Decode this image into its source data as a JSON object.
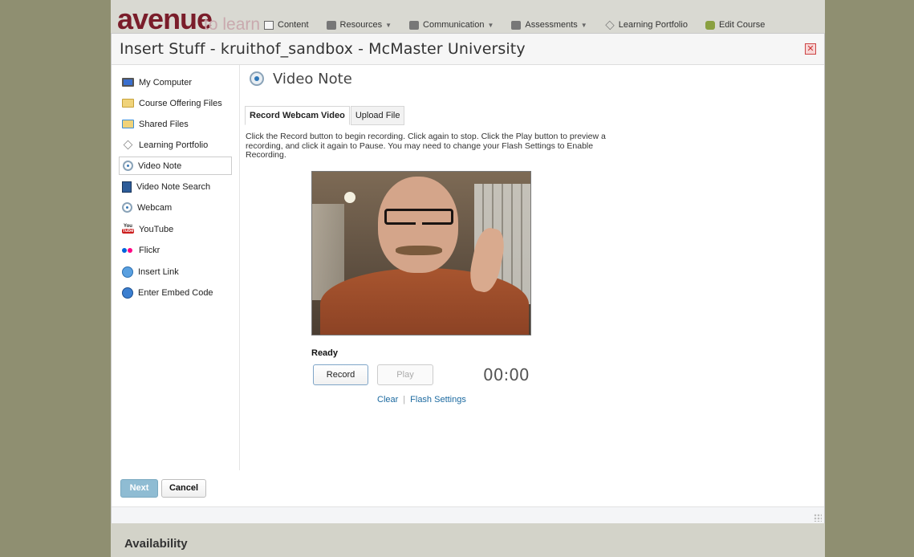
{
  "site": {
    "logo_main": "avenue",
    "logo_sub": "to learn",
    "nav": [
      {
        "label": "Content",
        "icon": "content-icon",
        "dropdown": false
      },
      {
        "label": "Resources",
        "icon": "resources-icon",
        "dropdown": true
      },
      {
        "label": "Communication",
        "icon": "communication-icon",
        "dropdown": true
      },
      {
        "label": "Assessments",
        "icon": "assessments-icon",
        "dropdown": true
      },
      {
        "label": "Learning Portfolio",
        "icon": "portfolio-icon",
        "dropdown": false
      },
      {
        "label": "Edit Course",
        "icon": "edit-course-icon",
        "dropdown": false
      }
    ],
    "availability_label": "Availability"
  },
  "dialog": {
    "title": "Insert Stuff - kruithof_sandbox - McMaster University",
    "close_glyph": "✕",
    "sidebar": [
      {
        "label": "My Computer",
        "icon": "computer-icon"
      },
      {
        "label": "Course Offering Files",
        "icon": "folder-icon"
      },
      {
        "label": "Shared Files",
        "icon": "shared-folder-icon"
      },
      {
        "label": "Learning Portfolio",
        "icon": "portfolio-icon"
      },
      {
        "label": "Video Note",
        "icon": "video-note-icon",
        "active": true
      },
      {
        "label": "Video Note Search",
        "icon": "video-search-icon"
      },
      {
        "label": "Webcam",
        "icon": "webcam-icon"
      },
      {
        "label": "YouTube",
        "icon": "youtube-icon"
      },
      {
        "label": "Flickr",
        "icon": "flickr-icon"
      },
      {
        "label": "Insert Link",
        "icon": "link-icon"
      },
      {
        "label": "Enter Embed Code",
        "icon": "embed-icon"
      }
    ],
    "main": {
      "title": "Video Note",
      "tabs": [
        {
          "label": "Record Webcam Video",
          "active": true
        },
        {
          "label": "Upload File",
          "active": false
        }
      ],
      "instructions": "Click the Record button to begin recording. Click again to stop. Click the Play button to preview a recording, and click it again to Pause. You may need to change your Flash Settings to Enable Recording.",
      "status": "Ready",
      "record_label": "Record",
      "play_label": "Play",
      "timer": "00:00",
      "clear_label": "Clear",
      "separator": "|",
      "flash_settings_label": "Flash Settings"
    },
    "footer": {
      "next_label": "Next",
      "cancel_label": "Cancel"
    }
  },
  "colors": {
    "backdrop": "#8f8f71",
    "logo": "#7a1d2a",
    "link": "#1c6aa0",
    "next_button": "#8fbcd3"
  }
}
